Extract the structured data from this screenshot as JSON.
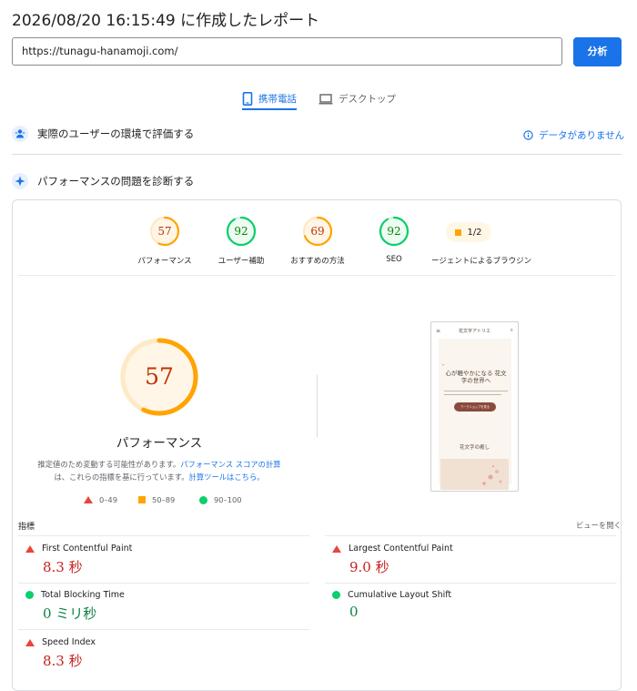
{
  "report": {
    "title": "2026/08/20 16:15:49 に作成したレポート"
  },
  "search": {
    "url": "https://tunagu-hanamoji.com/",
    "analyze_label": "分析"
  },
  "tabs": {
    "mobile": "携帯電話",
    "desktop": "デスクトップ"
  },
  "field_data": {
    "heading": "実際のユーザーの環境で評価する",
    "no_data": "データがありません"
  },
  "lab": {
    "heading": "パフォーマンスの問題を診断する"
  },
  "scores": [
    {
      "label": "パフォーマンス",
      "value": "57",
      "color": "#ffa400"
    },
    {
      "label": "ユーザー補助",
      "value": "92",
      "color": "#0cce6b"
    },
    {
      "label": "おすすめの方法",
      "value": "69",
      "color": "#ffa400"
    },
    {
      "label": "SEO",
      "value": "92",
      "color": "#0cce6b"
    }
  ],
  "pwa": {
    "label": "ージェントによるブラウジン",
    "value": "1/2"
  },
  "performance": {
    "score": "57",
    "title": "パフォーマンス",
    "desc_pre": "推定値のため変動する可能性があります。",
    "desc_link1": "パフォーマンス スコアの計算",
    "desc_mid": "は、これらの指標を基に行っています。",
    "desc_link2": "計算ツールはこちら。"
  },
  "legend": {
    "fail": "0–49",
    "average": "50–89",
    "pass": "90–100"
  },
  "phone_preview": {
    "site_name": "花文字アトリエ",
    "tagline": "心が軽やかになる 花文字の世界へ",
    "button": "ワークショップを見る",
    "section": "花文字の癒し"
  },
  "metrics": {
    "header": "指標",
    "expand": "ビューを開く",
    "fcp": {
      "name": "First Contentful Paint",
      "value": "8.3 秒",
      "color": "#c5221f"
    },
    "lcp": {
      "name": "Largest Contentful Paint",
      "value": "9.0 秒",
      "color": "#c5221f"
    },
    "tbt": {
      "name": "Total Blocking Time",
      "value": "0 ミリ秒",
      "color": "#0d8043"
    },
    "cls": {
      "name": "Cumulative Layout Shift",
      "value": "0",
      "color": "#0d8043"
    },
    "si": {
      "name": "Speed Index",
      "value": "8.3 秒",
      "color": "#c5221f"
    }
  }
}
